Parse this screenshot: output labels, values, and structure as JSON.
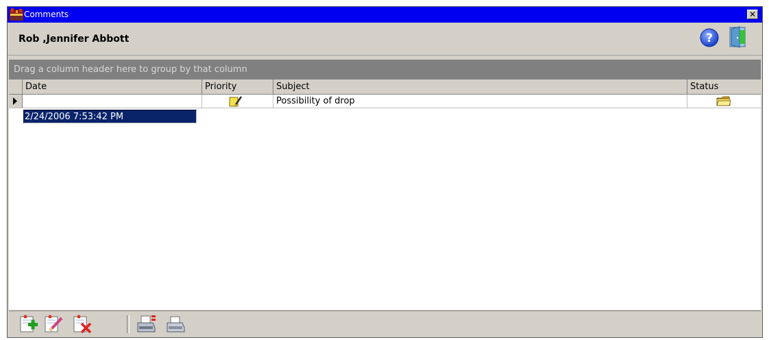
{
  "window": {
    "title": "Comments",
    "close_label": "✕"
  },
  "header": {
    "person_name": "Rob ,Jennifer Abbott",
    "icons": [
      "help-icon",
      "exit-door-icon"
    ]
  },
  "grid": {
    "group_hint": "Drag a column header here to group by that column",
    "columns": [
      {
        "label": "Date"
      },
      {
        "label": "Priority"
      },
      {
        "label": "Subject"
      },
      {
        "label": "Status"
      }
    ],
    "rows": [
      {
        "date": "2/24/2006 7:53:42 PM",
        "priority_icon": "note-pencil-icon",
        "subject": "Possibility of drop",
        "status_icon": "folder-icon",
        "selected": true
      }
    ]
  },
  "toolbar": {
    "buttons": [
      {
        "icon": "add-comment-icon"
      },
      {
        "icon": "edit-comment-icon"
      },
      {
        "icon": "delete-comment-icon"
      },
      {
        "icon": "print-list-icon"
      },
      {
        "icon": "print-icon"
      }
    ]
  },
  "colors": {
    "titlebar": "#0000f0",
    "selection": "#0a246a",
    "window_face": "#d4d0c8",
    "group_panel": "#808080"
  }
}
